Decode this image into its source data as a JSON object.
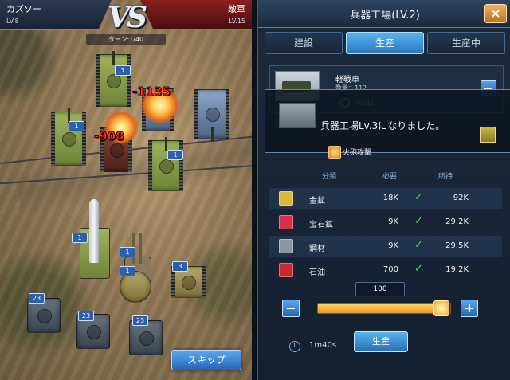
{
  "battle": {
    "player_name": "カズソー",
    "player_level": "LV.8",
    "enemy_name": "敵軍",
    "enemy_level": "LV.15",
    "vs_label": "VS",
    "turn_label": "ターン:1/40",
    "damage_numbers": [
      "-1135",
      "-908"
    ],
    "unit_counts": [
      "1",
      "1",
      "1",
      "1",
      "1",
      "1",
      "3",
      "23",
      "23",
      "23"
    ],
    "skip_label": "スキップ"
  },
  "factory": {
    "title": "兵器工場(LV.2)",
    "close_icon": "×",
    "tabs": [
      {
        "label": "建設",
        "active": false
      },
      {
        "label": "生産",
        "active": true
      },
      {
        "label": "生産中",
        "active": false
      }
    ],
    "item": {
      "name": "軽戦車",
      "count": "数量：112",
      "time": "0m1s"
    },
    "notice": "兵器工場Lv.3になりました。",
    "skill_label": "火砲攻撃",
    "cost_headers": {
      "category": "分類",
      "required": "必要",
      "owned": "所持"
    },
    "resources": [
      {
        "icon": "gold-bar-icon",
        "name": "金鉱",
        "required": "18K",
        "owned": "92K",
        "color": "#d8b83a"
      },
      {
        "icon": "gem-icon",
        "name": "宝石鉱",
        "required": "9K",
        "owned": "29.2K",
        "color": "#d8304a"
      },
      {
        "icon": "steel-icon",
        "name": "鋼材",
        "required": "9K",
        "owned": "29.5K",
        "color": "#8a96a2"
      },
      {
        "icon": "oil-can-icon",
        "name": "石油",
        "required": "700",
        "owned": "19.2K",
        "color": "#c8282a"
      }
    ],
    "quantity": "100",
    "slider_fraction": 0.93,
    "duration": "1m40s",
    "produce_label": "生産"
  }
}
